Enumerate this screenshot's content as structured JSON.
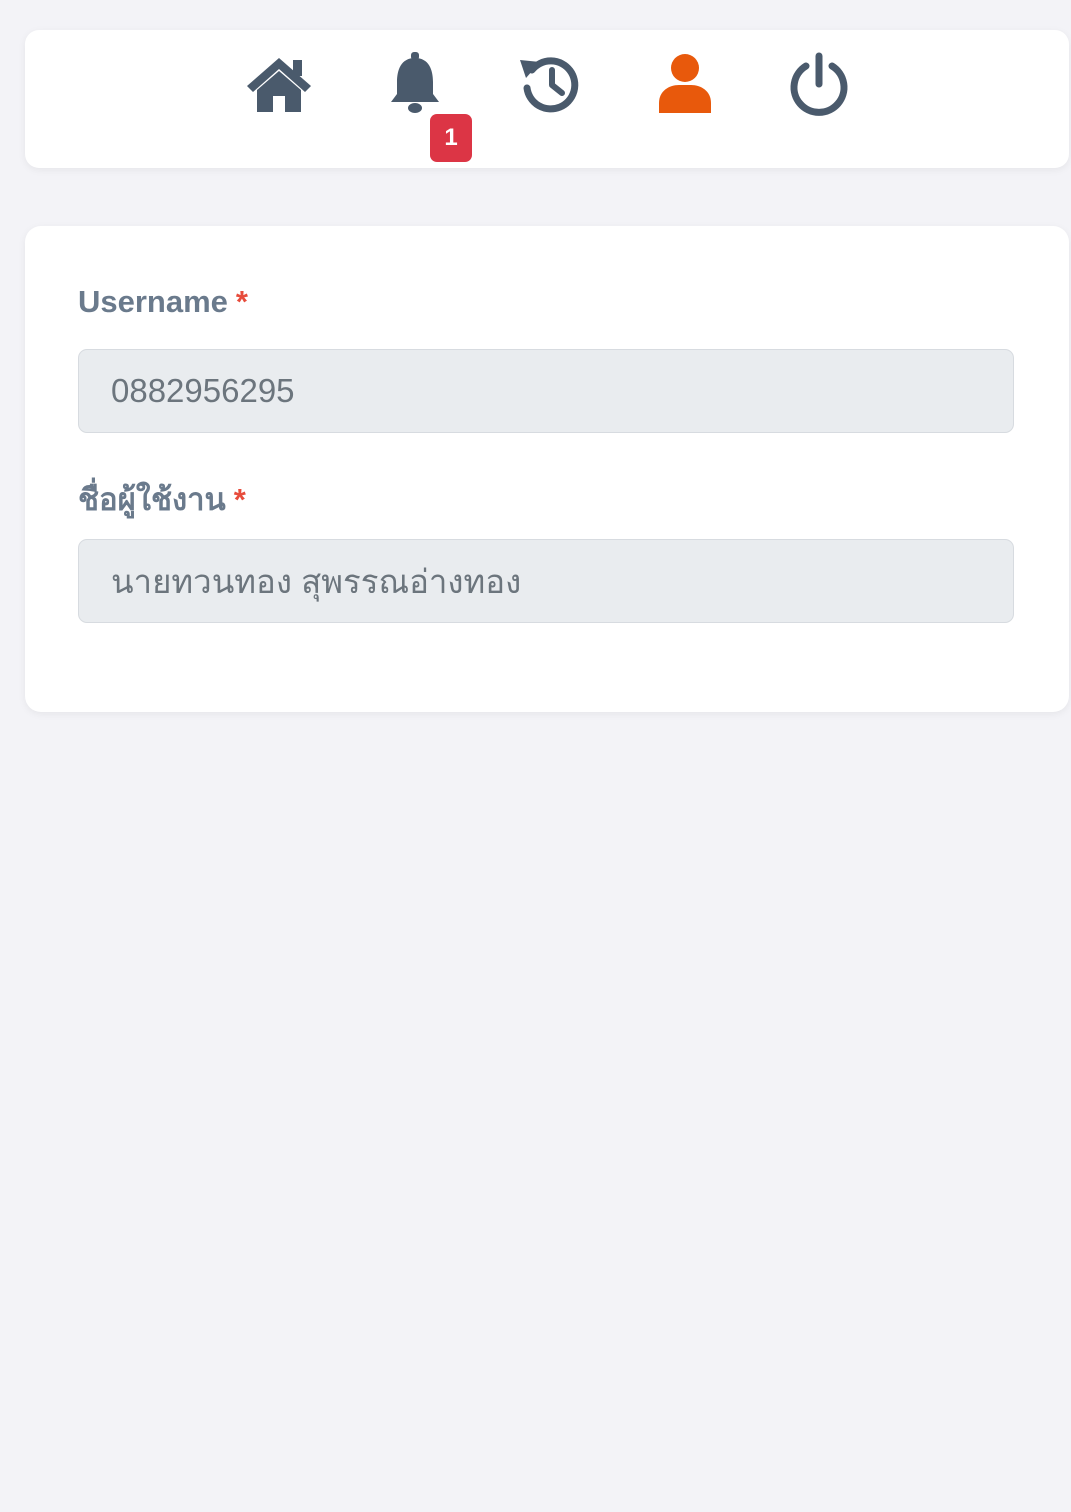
{
  "nav": {
    "items": [
      {
        "icon": "home-icon",
        "label": "home"
      },
      {
        "icon": "bell-icon",
        "label": "notifications"
      },
      {
        "icon": "history-icon",
        "label": "history"
      },
      {
        "icon": "user-icon",
        "label": "profile",
        "active": true
      },
      {
        "icon": "power-icon",
        "label": "logout"
      }
    ],
    "notification_count": "1",
    "colors": {
      "icon": "#4a5a6c",
      "active": "#e8590c",
      "badge": "#dc3545"
    }
  },
  "form": {
    "username_label": "Username",
    "username_required": "*",
    "username_value": "0882956295",
    "name_label": "ชื่อผู้ใช้งาน",
    "name_required": "*",
    "name_value": "นายทวนทอง สุพรรณอ่างทอง"
  }
}
